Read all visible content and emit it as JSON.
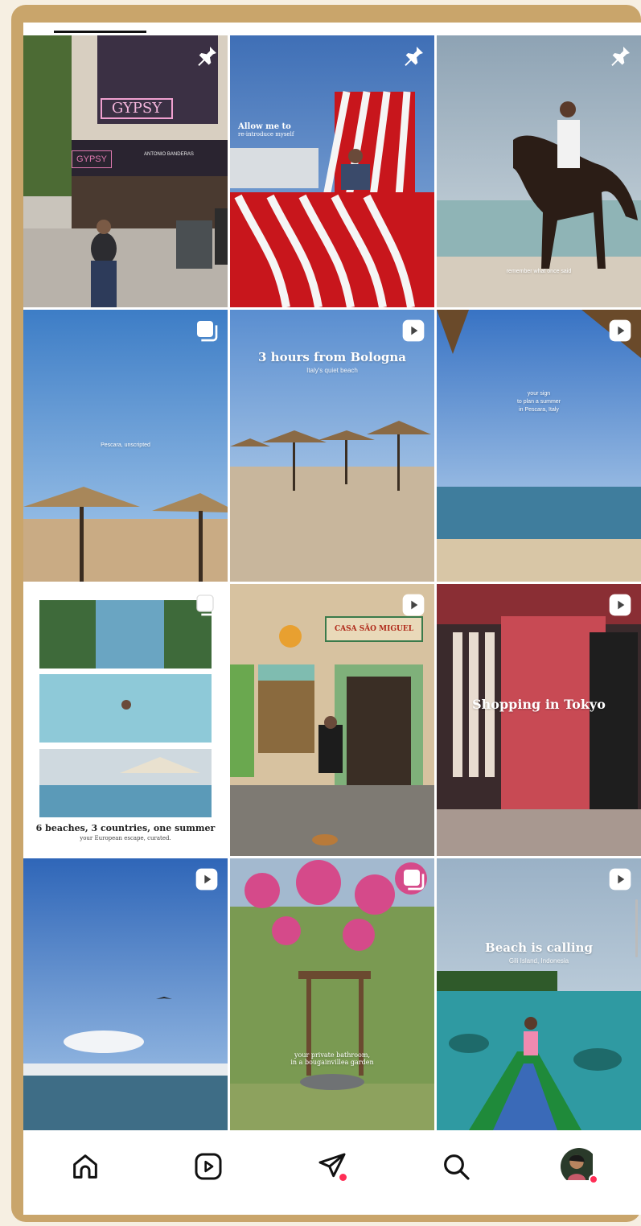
{
  "grid": {
    "posts": [
      {
        "id": "post-gypsy",
        "badge": "pin-icon",
        "caption": "",
        "sub": ""
      },
      {
        "id": "post-red-chair",
        "badge": "pin-icon",
        "caption": "Allow me to",
        "sub": "re-introduce myself"
      },
      {
        "id": "post-horse",
        "badge": "pin-icon",
        "caption": "",
        "sub": "remember what once said"
      },
      {
        "id": "post-pescara-unscripted",
        "badge": "carousel-icon",
        "caption": "",
        "sub": "Pescara, unscripted"
      },
      {
        "id": "post-bologna",
        "badge": "reel-icon",
        "caption": "3 hours from Bologna",
        "sub": "Italy's quiet beach"
      },
      {
        "id": "post-sign-summer",
        "badge": "reel-icon",
        "caption": "",
        "sub": "your sign\nto plan a summer\nin Pescara, Italy"
      },
      {
        "id": "post-beaches-collage",
        "badge": "carousel-icon",
        "caption": "6 beaches, 3 countries, one summer",
        "sub": "your European escape, curated."
      },
      {
        "id": "post-casa-sao-miguel",
        "badge": "reel-icon",
        "caption": "",
        "sub": "",
        "shop_sign": "CASA SÃO MIGUEL"
      },
      {
        "id": "post-tokyo",
        "badge": "reel-icon",
        "caption": "Shopping in Tokyo",
        "sub": ""
      },
      {
        "id": "post-sea-bird",
        "badge": "reel-icon",
        "caption": "",
        "sub": ""
      },
      {
        "id": "post-bougainvillea",
        "badge": "carousel-icon",
        "caption": "",
        "sub": "your private bathroom,\nin a bougainvillea garden"
      },
      {
        "id": "post-gili",
        "badge": "reel-icon",
        "caption": "Beach is calling",
        "sub": "Gili Island, Indonesia"
      }
    ],
    "signs": {
      "gypsy": "GYPSY",
      "theatre_sub": "ANTONIO BANDERAS"
    }
  },
  "nav": {
    "items": [
      {
        "name": "home",
        "icon": "home-icon"
      },
      {
        "name": "reels",
        "icon": "reels-icon"
      },
      {
        "name": "messages",
        "icon": "direct-send-icon",
        "notification": true
      },
      {
        "name": "search",
        "icon": "search-icon"
      },
      {
        "name": "profile",
        "icon": "avatar",
        "notification": true
      }
    ]
  },
  "colors": {
    "frame": "#c9a56b",
    "page_bg": "#f6efe2",
    "notification": "#ff2d55"
  }
}
